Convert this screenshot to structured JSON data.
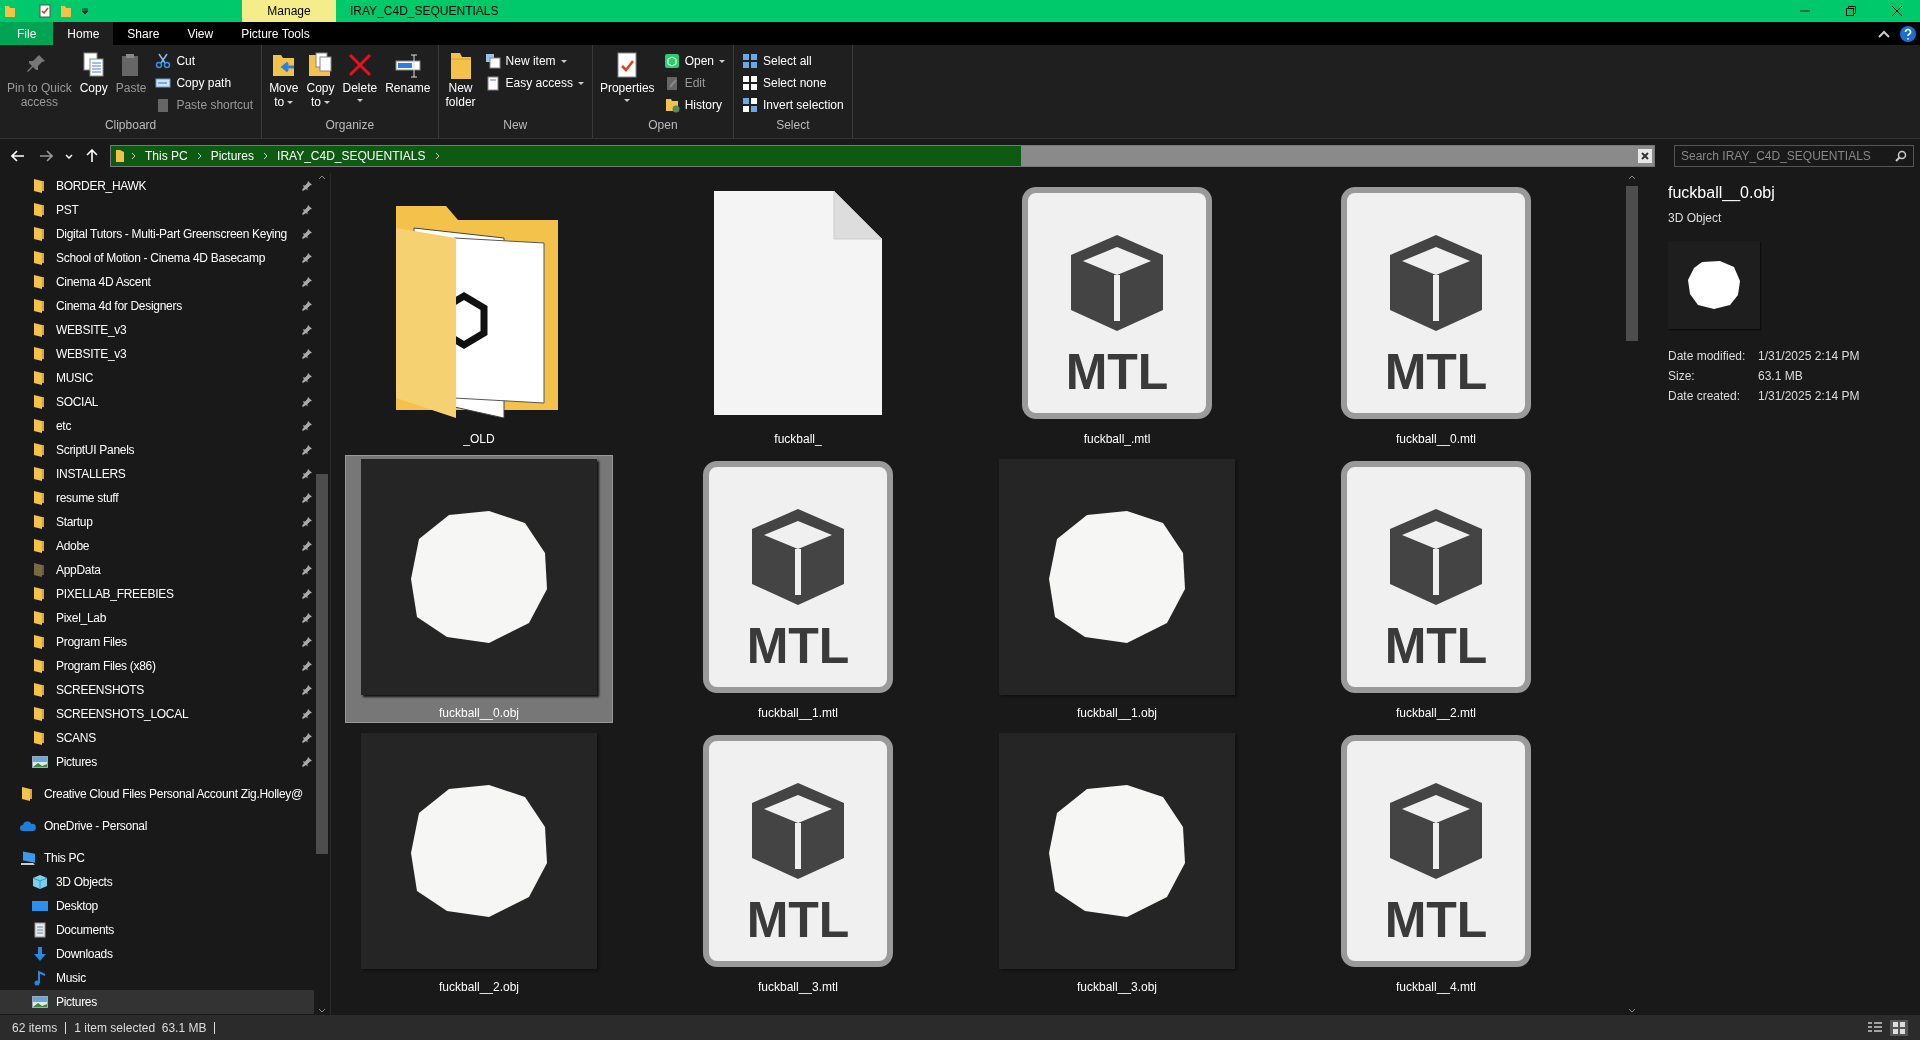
{
  "title_bar": {
    "contextual_tab": "Manage",
    "title": "IRAY_C4D_SEQUENTIALS"
  },
  "ribbon_tabs": [
    {
      "label": "File",
      "kind": "file",
      "selected": false
    },
    {
      "label": "Home",
      "kind": "tab",
      "selected": true
    },
    {
      "label": "Share",
      "kind": "tab",
      "selected": false
    },
    {
      "label": "View",
      "kind": "tab",
      "selected": false
    },
    {
      "label": "Picture Tools",
      "kind": "tab",
      "selected": false
    }
  ],
  "ribbon_groups": [
    {
      "label": "Clipboard",
      "large": [
        {
          "kind": "pin",
          "lines": [
            "Pin to Quick",
            "access"
          ],
          "disabled": true,
          "caret": false
        },
        {
          "kind": "copy",
          "lines": [
            "Copy"
          ],
          "disabled": false,
          "caret": false
        },
        {
          "kind": "paste",
          "lines": [
            "Paste"
          ],
          "disabled": true,
          "caret": false
        }
      ],
      "small": [
        {
          "kind": "cut",
          "label": "Cut",
          "disabled": false,
          "caret": false
        },
        {
          "kind": "copypath",
          "label": "Copy path",
          "disabled": false,
          "caret": false
        },
        {
          "kind": "pasteshortcut",
          "label": "Paste shortcut",
          "disabled": true,
          "caret": false
        }
      ]
    },
    {
      "label": "Organize",
      "large": [
        {
          "kind": "move",
          "lines": [
            "Move",
            "to"
          ],
          "disabled": false,
          "caret": true
        },
        {
          "kind": "copyto",
          "lines": [
            "Copy",
            "to"
          ],
          "disabled": false,
          "caret": true
        },
        {
          "kind": "delete",
          "lines": [
            "Delete"
          ],
          "disabled": false,
          "caret": true
        },
        {
          "kind": "rename",
          "lines": [
            "Rename"
          ],
          "disabled": false,
          "caret": false
        }
      ]
    },
    {
      "label": "New",
      "large": [
        {
          "kind": "newfolder",
          "lines": [
            "New",
            "folder"
          ],
          "disabled": false,
          "caret": false
        }
      ],
      "small": [
        {
          "kind": "newitem",
          "label": "New item",
          "disabled": false,
          "caret": true
        },
        {
          "kind": "easyaccess",
          "label": "Easy access",
          "disabled": false,
          "caret": true
        }
      ]
    },
    {
      "label": "Open",
      "large": [
        {
          "kind": "properties",
          "lines": [
            "Properties"
          ],
          "disabled": false,
          "caret": true
        }
      ],
      "small": [
        {
          "kind": "open",
          "label": "Open",
          "disabled": false,
          "caret": true
        },
        {
          "kind": "edit",
          "label": "Edit",
          "disabled": true,
          "caret": false
        },
        {
          "kind": "history",
          "label": "History",
          "disabled": false,
          "caret": false
        }
      ]
    },
    {
      "label": "Select",
      "small": [
        {
          "kind": "selectall",
          "label": "Select all",
          "disabled": false,
          "caret": false
        },
        {
          "kind": "selectnone",
          "label": "Select none",
          "disabled": false,
          "caret": false
        },
        {
          "kind": "invert",
          "label": "Invert selection",
          "disabled": false,
          "caret": false
        }
      ]
    }
  ],
  "address_bar": {
    "path": [
      "This PC",
      "Pictures",
      "IRAY_C4D_SEQUENTIALS"
    ],
    "level": 0.59
  },
  "search": {
    "placeholder": "Search IRAY_C4D_SEQUENTIALS"
  },
  "nav_pane": {
    "quick_access": [
      {
        "label": "BORDER_HAWK",
        "kind": "folder",
        "selected": false
      },
      {
        "label": "PST",
        "kind": "folder",
        "selected": false
      },
      {
        "label": "Digital Tutors - Multi-Part Greenscreen Keying",
        "kind": "folder",
        "selected": false
      },
      {
        "label": "School of Motion - Cinema 4D Basecamp",
        "kind": "folder",
        "selected": false
      },
      {
        "label": "Cinema 4D Ascent",
        "kind": "folder",
        "selected": false
      },
      {
        "label": "Cinema 4d for Designers",
        "kind": "folder",
        "selected": false
      },
      {
        "label": "WEBSITE_v3",
        "kind": "folder",
        "selected": false
      },
      {
        "label": "WEBSITE_v3",
        "kind": "folder",
        "selected": false
      },
      {
        "label": "MUSIC",
        "kind": "folder",
        "selected": false
      },
      {
        "label": "SOCIAL",
        "kind": "folder",
        "selected": false
      },
      {
        "label": "etc",
        "kind": "folder",
        "selected": false
      },
      {
        "label": "ScriptUI Panels",
        "kind": "folder",
        "selected": false
      },
      {
        "label": "INSTALLERS",
        "kind": "folder",
        "selected": false
      },
      {
        "label": "resume stuff",
        "kind": "folder",
        "selected": false
      },
      {
        "label": "Startup",
        "kind": "folder",
        "selected": false
      },
      {
        "label": "Adobe",
        "kind": "folder",
        "selected": false
      },
      {
        "label": "AppData",
        "kind": "hidden-folder",
        "selected": false
      },
      {
        "label": "PIXELLAB_FREEBIES",
        "kind": "folder",
        "selected": false
      },
      {
        "label": "Pixel_Lab",
        "kind": "folder",
        "selected": false
      },
      {
        "label": "Program Files",
        "kind": "folder",
        "selected": false
      },
      {
        "label": "Program Files (x86)",
        "kind": "folder",
        "selected": false
      },
      {
        "label": "SCREENSHOTS",
        "kind": "folder",
        "selected": false
      },
      {
        "label": "SCREENSHOTS_LOCAL",
        "kind": "folder",
        "selected": false
      },
      {
        "label": "SCANS",
        "kind": "folder",
        "selected": false
      },
      {
        "label": "Pictures",
        "kind": "pictures",
        "selected": false
      }
    ],
    "locations": [
      {
        "label": "Creative Cloud Files Personal Account Zig.Holley@",
        "kind": "folder",
        "selected": false
      },
      {
        "label": "OneDrive - Personal",
        "kind": "cloud",
        "selected": false
      },
      {
        "label": "This PC",
        "kind": "pc",
        "selected": false,
        "children": [
          {
            "label": "3D Objects",
            "kind": "objects3d",
            "selected": false
          },
          {
            "label": "Desktop",
            "kind": "desktop",
            "selected": false
          },
          {
            "label": "Documents",
            "kind": "documents",
            "selected": false
          },
          {
            "label": "Downloads",
            "kind": "downloads",
            "selected": false
          },
          {
            "label": "Music",
            "kind": "music",
            "selected": false
          },
          {
            "label": "Pictures",
            "kind": "pictures",
            "selected": true
          }
        ]
      }
    ]
  },
  "files": [
    {
      "name": "_OLD",
      "kind": "folder",
      "selected": false
    },
    {
      "name": "fuckball_",
      "kind": "blank",
      "selected": false
    },
    {
      "name": "fuckball_.mtl",
      "kind": "mtl",
      "badge": "MTL",
      "selected": false
    },
    {
      "name": "fuckball__0.mtl",
      "kind": "mtl",
      "badge": "MTL",
      "selected": false
    },
    {
      "name": "fuckball__0.obj",
      "kind": "obj",
      "selected": true
    },
    {
      "name": "fuckball__1.mtl",
      "kind": "mtl",
      "badge": "MTL",
      "selected": false
    },
    {
      "name": "fuckball__1.obj",
      "kind": "obj",
      "selected": false
    },
    {
      "name": "fuckball__2.mtl",
      "kind": "mtl",
      "badge": "MTL",
      "selected": false
    },
    {
      "name": "fuckball__2.obj",
      "kind": "obj",
      "selected": false
    },
    {
      "name": "fuckball__3.mtl",
      "kind": "mtl",
      "badge": "MTL",
      "selected": false
    },
    {
      "name": "fuckball__3.obj",
      "kind": "obj",
      "selected": false
    },
    {
      "name": "fuckball__4.mtl",
      "kind": "mtl",
      "badge": "MTL",
      "selected": false
    }
  ],
  "details_pane": {
    "name": "fuckball__0.obj",
    "type": "3D Object",
    "properties": [
      {
        "label": "Date modified:",
        "value": "1/31/2025 2:14 PM"
      },
      {
        "label": "Size:",
        "value": "63.1 MB"
      },
      {
        "label": "Date created:",
        "value": "1/31/2025 2:14 PM"
      }
    ]
  },
  "status_bar": {
    "item_count": "62 items",
    "selection": "1 item selected  63.1 MB"
  }
}
